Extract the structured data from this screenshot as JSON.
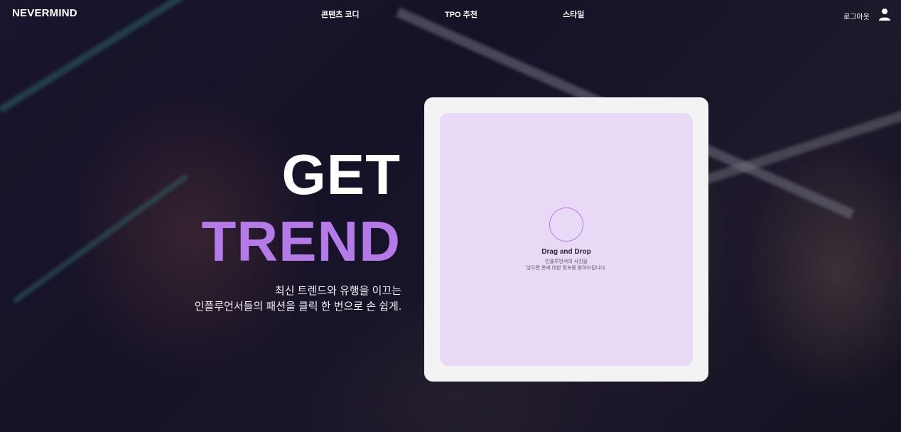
{
  "nav": {
    "logo": "NEVERMIND",
    "links": [
      "콘텐츠 코디",
      "TPO 추천",
      "스타일"
    ],
    "logout": "로그아웃",
    "user_icon": "user-icon"
  },
  "hero": {
    "line1": "GET",
    "line2": "TREND",
    "tagline1": "최신 트렌드와 유행을 이끄는",
    "tagline2": "인플루언서들의 패션을 클릭 한 번으로 손 쉽게.",
    "accent_color": "#b47ae8"
  },
  "upload": {
    "title": "Drag and Drop",
    "subtitle1": "인플루언서의 사진을",
    "subtitle2": "넣으면 옷에 대한 정보를 찾아드립니다."
  }
}
